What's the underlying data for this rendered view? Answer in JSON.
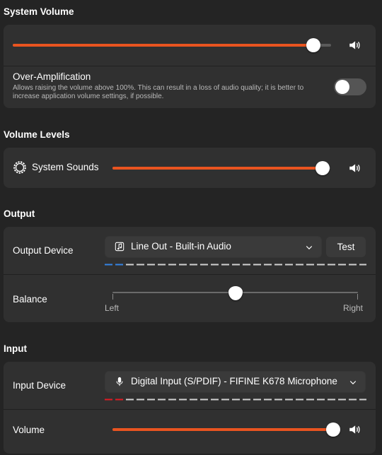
{
  "system_volume": {
    "title": "System Volume",
    "level": 0.945,
    "over_amp_label": "Over-Amplification",
    "over_amp_desc": "Allows raising the volume above 100%. This can result in a loss of audio quality; it is better to increase application volume settings, if possible.",
    "over_amp_enabled": false
  },
  "volume_levels": {
    "title": "Volume Levels",
    "system_sounds_label": "System Sounds",
    "system_sounds_level": 0.965
  },
  "output": {
    "title": "Output",
    "device_label": "Output Device",
    "device_value": "Line Out - Built-in Audio",
    "test_label": "Test",
    "balance_label": "Balance",
    "balance_value": 0.5,
    "left_label": "Left",
    "right_label": "Right"
  },
  "input": {
    "title": "Input",
    "device_label": "Input Device",
    "device_value": "Digital Input (S/PDIF) - FIFINE K678 Microphone",
    "volume_label": "Volume",
    "volume_level": 0.975
  },
  "colors": {
    "accent": "#e95420",
    "output_level": "#3584e4",
    "input_level": "#e01b24"
  },
  "icons": [
    "speaker-icon",
    "gear-icon",
    "music-note-icon",
    "microphone-icon",
    "chevron-down-icon"
  ]
}
